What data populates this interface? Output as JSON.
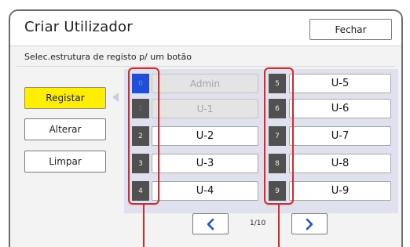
{
  "dialog": {
    "title": "Criar Utilizador",
    "close_label": "Fechar",
    "instruction": "Selec.estrutura de registo p/ um botão"
  },
  "actions": [
    {
      "label": "Registar",
      "selected": true
    },
    {
      "label": "Alterar"
    },
    {
      "label": "Limpar"
    }
  ],
  "left_slots": [
    {
      "number": "0",
      "label": "Admin",
      "state": "disabled-active"
    },
    {
      "number": "1",
      "label": "U-1",
      "state": "disabled"
    },
    {
      "number": "2",
      "label": "U-2"
    },
    {
      "number": "3",
      "label": "U-3"
    },
    {
      "number": "4",
      "label": "U-4"
    }
  ],
  "right_slots": [
    {
      "number": "5",
      "label": "U-5"
    },
    {
      "number": "6",
      "label": "U-6"
    },
    {
      "number": "7",
      "label": "U-7"
    },
    {
      "number": "8",
      "label": "U-8"
    },
    {
      "number": "9",
      "label": "U-9"
    }
  ],
  "pagination": {
    "page_text": "1/10",
    "prev_icon": "chevron-left-icon",
    "next_icon": "chevron-right-icon"
  },
  "colors": {
    "selected_button": "#ffee00",
    "active_number": "#1f4fd8",
    "highlight": "#e12626",
    "nav_arrow": "#1a55d6"
  }
}
